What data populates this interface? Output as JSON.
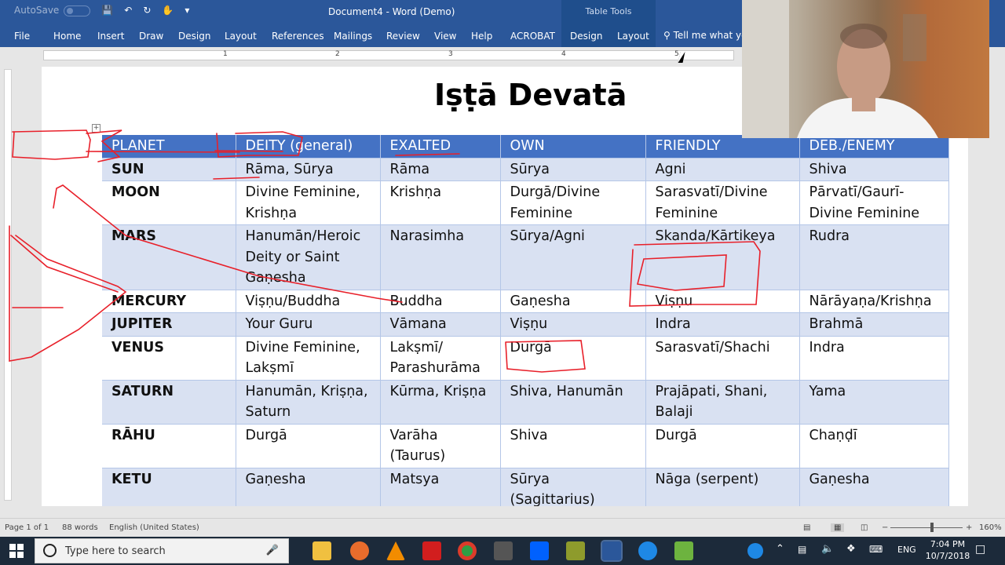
{
  "titlebar": {
    "autosave": "AutoSave",
    "autosave_state": "Off",
    "document_title": "Document4 - Word (Demo)",
    "context_tools": "Table Tools"
  },
  "ribbon": {
    "tabs": [
      "File",
      "Home",
      "Insert",
      "Draw",
      "Design",
      "Layout",
      "References",
      "Mailings",
      "Review",
      "View",
      "Help",
      "ACROBAT",
      "Design",
      "Layout"
    ],
    "tell_me": "Tell me what yo"
  },
  "ruler": {
    "numbers": [
      "1",
      "2",
      "3",
      "4",
      "5"
    ]
  },
  "document": {
    "heading": "Iṣṭā Devatā",
    "table": {
      "headers": [
        "PLANET",
        "DEITY (general)",
        "EXALTED",
        "OWN",
        "FRIENDLY",
        "DEB./ENEMY"
      ],
      "rows": [
        [
          "SUN",
          "Rāma, Sūrya",
          "Rāma",
          "Sūrya",
          "Agni",
          "Shiva"
        ],
        [
          "MOON",
          "Divine Feminine, Krishṇa",
          "Krishṇa",
          "Durgā/Divine Feminine",
          "Sarasvatī/Divine Feminine",
          "Pārvatī/Gaurī-Divine Feminine"
        ],
        [
          "MARS",
          "Hanumān/Heroic Deity or Saint Gaṇesha",
          "Narasimha",
          "Sūrya/Agni",
          "Skanda/Kārtikeya",
          "Rudra"
        ],
        [
          "MERCURY",
          "Viṣṇu/Buddha",
          "Buddha",
          "Gaṇesha",
          "Viṣṇu",
          "Nārāyaṇa/Krishṇa"
        ],
        [
          "JUPITER",
          "Your Guru",
          "Vāmana",
          "Viṣṇu",
          "Indra",
          "Brahmā"
        ],
        [
          "VENUS",
          "Divine Feminine, Lakṣmī",
          "Lakṣmī/ Parashurāma",
          "Durgā",
          "Sarasvatī/Shachi",
          "Indra"
        ],
        [
          "SATURN",
          "Hanumān, Kriṣṇa, Saturn",
          "Kūrma, Kriṣṇa",
          "Shiva, Hanumān",
          "Prajāpati, Shani, Balaji",
          "Yama"
        ],
        [
          "RĀHU",
          "Durgā",
          "Varāha (Taurus)",
          "Shiva",
          "Durgā",
          "Chaṇḍī"
        ],
        [
          "KETU",
          "Gaṇesha",
          "Matsya",
          "Sūrya (Sagittarius)",
          "Nāga (serpent)",
          "Gaṇesha"
        ]
      ]
    }
  },
  "statusbar": {
    "page": "Page 1 of 1",
    "words": "88 words",
    "language": "English (United States)",
    "zoom": "160%"
  },
  "taskbar": {
    "search_placeholder": "Type here to search",
    "language": "ENG",
    "time": "7:04 PM",
    "date": "10/7/2018"
  },
  "colors": {
    "word_blue": "#2b579a",
    "table_header": "#4472c4",
    "table_band": "#d9e1f2",
    "ink": "#e8202a"
  }
}
